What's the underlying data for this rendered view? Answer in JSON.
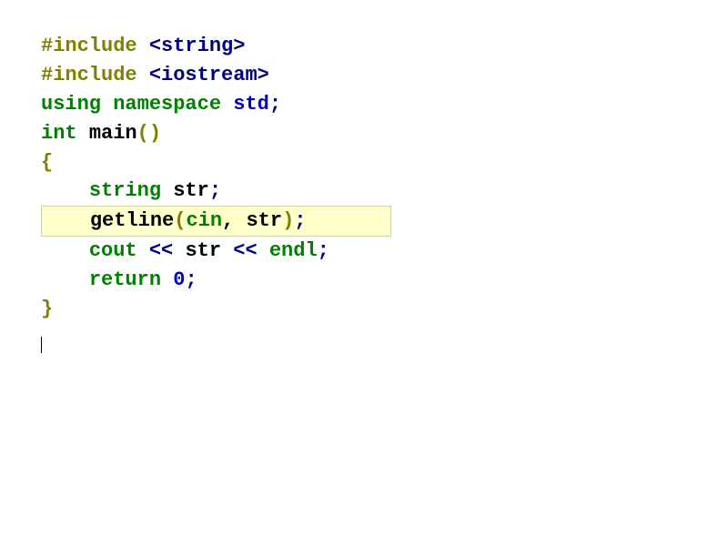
{
  "code": {
    "line1": {
      "preproc": "#include ",
      "lt": "<",
      "lib": "string",
      "gt": ">"
    },
    "line2": {
      "preproc": "#include ",
      "lt": "<",
      "lib": "iostream",
      "gt": ">"
    },
    "line3": {
      "using": "using ",
      "namespace": "namespace ",
      "std": "std",
      "semi": ";"
    },
    "line4": {
      "int": "int ",
      "main": "main",
      "paren": "()"
    },
    "line5": {
      "brace": "{"
    },
    "line6": {
      "indent": "    ",
      "string": "string ",
      "var": "str",
      "semi": ";"
    },
    "line7": {
      "indent": "    ",
      "getline": "getline",
      "lparen": "(",
      "cin": "cin",
      "comma": ", ",
      "var": "str",
      "rparen": ")",
      "semi": ";"
    },
    "line8": {
      "indent": "    ",
      "cout": "cout ",
      "op1": "<< ",
      "var": "str ",
      "op2": "<< ",
      "endl": "endl",
      "semi": ";"
    },
    "line9": {
      "indent": "    ",
      "return": "return ",
      "zero": "0",
      "semi": ";"
    },
    "line10": {
      "brace": "}"
    }
  }
}
